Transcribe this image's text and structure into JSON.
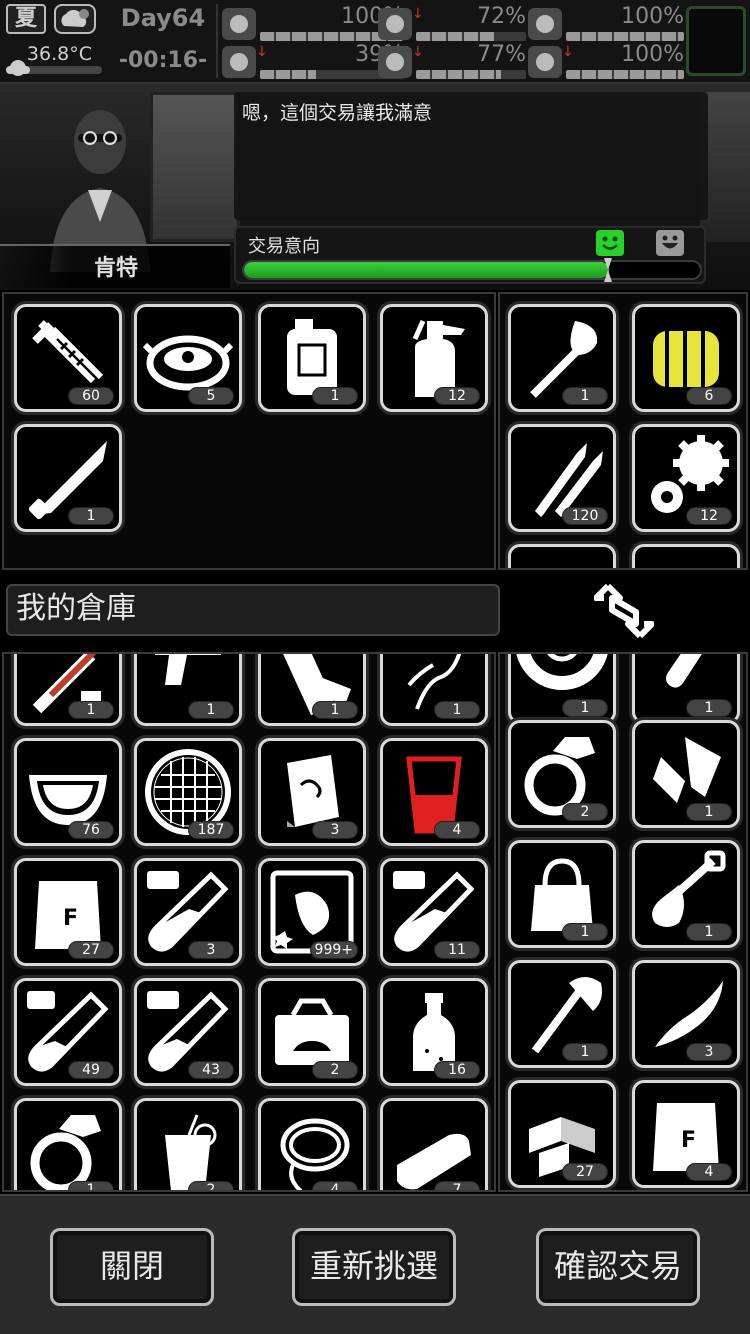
{
  "status": {
    "season": "夏",
    "weather_icon": "cloud-moon-icon",
    "temperature": "36.8°C",
    "day": "Day64",
    "clock": "-00:16-",
    "stats": [
      {
        "name": "health",
        "icon": "medkit-icon",
        "value": "100%",
        "level": 1.0,
        "arrow": ""
      },
      {
        "name": "hunger",
        "icon": "stomach-icon",
        "value": "72%",
        "level": 0.72,
        "arrow": "↓"
      },
      {
        "name": "medicine",
        "icon": "pill-icon",
        "value": "100%",
        "level": 1.0,
        "arrow": ""
      },
      {
        "name": "stamina",
        "icon": "boot-icon",
        "value": "39%",
        "level": 0.39,
        "arrow": "↓"
      },
      {
        "name": "thirst",
        "icon": "water-drop-icon",
        "value": "77%",
        "level": 0.77,
        "arrow": "↓"
      },
      {
        "name": "mood",
        "icon": "heart-icon",
        "value": "100%",
        "level": 1.0,
        "arrow": "↓"
      }
    ]
  },
  "npc": {
    "name": "肯特",
    "speech": "嗯，這個交易讓我滿意",
    "trade_label": "交易意向",
    "trade_level": 0.8
  },
  "npc_inventory_left": [
    {
      "icon": "nails-icon",
      "count": "60"
    },
    {
      "icon": "pot-icon",
      "count": "5"
    },
    {
      "icon": "jerrycan-icon",
      "count": "1"
    },
    {
      "icon": "spray-bottle-icon",
      "count": "12"
    },
    {
      "icon": "machete-icon",
      "count": "1"
    }
  ],
  "npc_inventory_right": [
    {
      "icon": "shovel-head-icon",
      "count": "1"
    },
    {
      "icon": "spring-icon",
      "count": "6"
    },
    {
      "icon": "bullets-icon",
      "count": "120"
    },
    {
      "icon": "gears-icon",
      "count": "12"
    }
  ],
  "storage": {
    "label": "我的倉庫",
    "swap_icon": "swap-arrows-icon"
  },
  "my_inventory_left": [
    {
      "icon": "syringe-knife-icon",
      "count": "1"
    },
    {
      "icon": "pistol-icon",
      "count": "1"
    },
    {
      "icon": "planks-icon",
      "count": "1"
    },
    {
      "icon": "wire-icon",
      "count": "1"
    },
    {
      "icon": "watermelon-icon",
      "count": "76"
    },
    {
      "icon": "sieve-icon",
      "count": "187"
    },
    {
      "icon": "book-icon",
      "count": "3"
    },
    {
      "icon": "red-cup-icon",
      "count": "4"
    },
    {
      "icon": "flour-bag-icon",
      "count": "27"
    },
    {
      "icon": "test-tube-vii-icon",
      "count": "3"
    },
    {
      "icon": "blueprint-icon",
      "count": "999+"
    },
    {
      "icon": "test-tube-vi-icon",
      "count": "11"
    },
    {
      "icon": "test-tube-i-icon",
      "count": "49"
    },
    {
      "icon": "test-tube-ii-icon",
      "count": "43"
    },
    {
      "icon": "car-toolbox-icon",
      "count": "2"
    },
    {
      "icon": "bottle-icon",
      "count": "16"
    },
    {
      "icon": "ring-icon",
      "count": "1"
    },
    {
      "icon": "juice-glass-icon",
      "count": "2"
    },
    {
      "icon": "rope-icon",
      "count": "4"
    },
    {
      "icon": "bread-icon",
      "count": "7"
    }
  ],
  "my_inventory_right": [
    {
      "icon": "tire-icon",
      "count": "1"
    },
    {
      "icon": "test-tube-icon",
      "count": "1"
    },
    {
      "icon": "ring-icon",
      "count": "2"
    },
    {
      "icon": "tape-icon",
      "count": "1"
    },
    {
      "icon": "bag-icon",
      "count": "1"
    },
    {
      "icon": "shovel-icon",
      "count": "1"
    },
    {
      "icon": "axe-icon",
      "count": "1"
    },
    {
      "icon": "knife-icon",
      "count": "3"
    },
    {
      "icon": "wood-blocks-icon",
      "count": "27"
    },
    {
      "icon": "flour-bag-icon",
      "count": "4"
    }
  ],
  "footer": {
    "close": "關閉",
    "reselect": "重新挑選",
    "confirm": "確認交易"
  }
}
